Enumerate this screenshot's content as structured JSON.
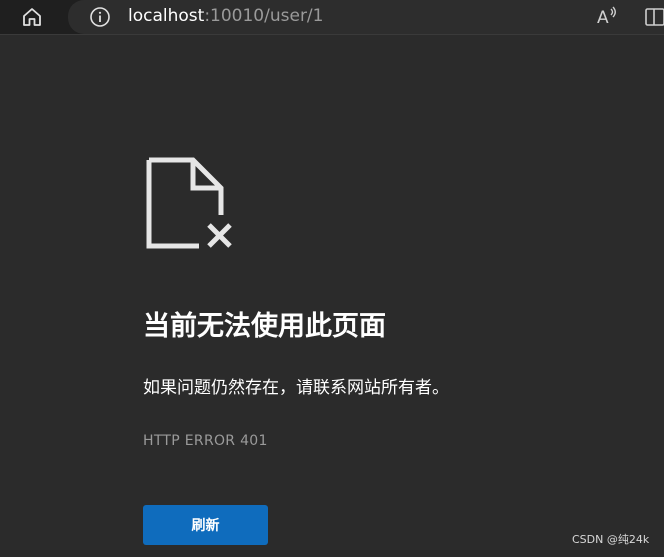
{
  "browser": {
    "url_host": "localhost",
    "url_path": ":10010/user/1",
    "read_aloud_label": "A"
  },
  "error_page": {
    "title": "当前无法使用此页面",
    "message": "如果问题仍然存在，请联系网站所有者。",
    "error_code": "HTTP ERROR 401",
    "refresh_label": "刷新"
  },
  "watermark": "CSDN @纯24k",
  "colors": {
    "page_bg": "#2b2b2b",
    "toolbar_bg": "#1f1f1f",
    "button_bg": "#0f6cbd",
    "text_primary": "#ffffff",
    "text_muted": "#9a9a9a"
  }
}
